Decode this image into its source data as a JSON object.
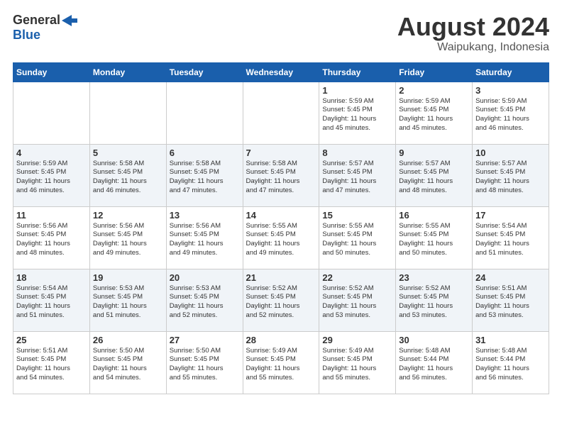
{
  "header": {
    "logo_general": "General",
    "logo_blue": "Blue",
    "month_year": "August 2024",
    "location": "Waipukang, Indonesia"
  },
  "weekdays": [
    "Sunday",
    "Monday",
    "Tuesday",
    "Wednesday",
    "Thursday",
    "Friday",
    "Saturday"
  ],
  "weeks": [
    [
      {
        "day": "",
        "info": ""
      },
      {
        "day": "",
        "info": ""
      },
      {
        "day": "",
        "info": ""
      },
      {
        "day": "",
        "info": ""
      },
      {
        "day": "1",
        "info": "Sunrise: 5:59 AM\nSunset: 5:45 PM\nDaylight: 11 hours\nand 45 minutes."
      },
      {
        "day": "2",
        "info": "Sunrise: 5:59 AM\nSunset: 5:45 PM\nDaylight: 11 hours\nand 45 minutes."
      },
      {
        "day": "3",
        "info": "Sunrise: 5:59 AM\nSunset: 5:45 PM\nDaylight: 11 hours\nand 46 minutes."
      }
    ],
    [
      {
        "day": "4",
        "info": "Sunrise: 5:59 AM\nSunset: 5:45 PM\nDaylight: 11 hours\nand 46 minutes."
      },
      {
        "day": "5",
        "info": "Sunrise: 5:58 AM\nSunset: 5:45 PM\nDaylight: 11 hours\nand 46 minutes."
      },
      {
        "day": "6",
        "info": "Sunrise: 5:58 AM\nSunset: 5:45 PM\nDaylight: 11 hours\nand 47 minutes."
      },
      {
        "day": "7",
        "info": "Sunrise: 5:58 AM\nSunset: 5:45 PM\nDaylight: 11 hours\nand 47 minutes."
      },
      {
        "day": "8",
        "info": "Sunrise: 5:57 AM\nSunset: 5:45 PM\nDaylight: 11 hours\nand 47 minutes."
      },
      {
        "day": "9",
        "info": "Sunrise: 5:57 AM\nSunset: 5:45 PM\nDaylight: 11 hours\nand 48 minutes."
      },
      {
        "day": "10",
        "info": "Sunrise: 5:57 AM\nSunset: 5:45 PM\nDaylight: 11 hours\nand 48 minutes."
      }
    ],
    [
      {
        "day": "11",
        "info": "Sunrise: 5:56 AM\nSunset: 5:45 PM\nDaylight: 11 hours\nand 48 minutes."
      },
      {
        "day": "12",
        "info": "Sunrise: 5:56 AM\nSunset: 5:45 PM\nDaylight: 11 hours\nand 49 minutes."
      },
      {
        "day": "13",
        "info": "Sunrise: 5:56 AM\nSunset: 5:45 PM\nDaylight: 11 hours\nand 49 minutes."
      },
      {
        "day": "14",
        "info": "Sunrise: 5:55 AM\nSunset: 5:45 PM\nDaylight: 11 hours\nand 49 minutes."
      },
      {
        "day": "15",
        "info": "Sunrise: 5:55 AM\nSunset: 5:45 PM\nDaylight: 11 hours\nand 50 minutes."
      },
      {
        "day": "16",
        "info": "Sunrise: 5:55 AM\nSunset: 5:45 PM\nDaylight: 11 hours\nand 50 minutes."
      },
      {
        "day": "17",
        "info": "Sunrise: 5:54 AM\nSunset: 5:45 PM\nDaylight: 11 hours\nand 51 minutes."
      }
    ],
    [
      {
        "day": "18",
        "info": "Sunrise: 5:54 AM\nSunset: 5:45 PM\nDaylight: 11 hours\nand 51 minutes."
      },
      {
        "day": "19",
        "info": "Sunrise: 5:53 AM\nSunset: 5:45 PM\nDaylight: 11 hours\nand 51 minutes."
      },
      {
        "day": "20",
        "info": "Sunrise: 5:53 AM\nSunset: 5:45 PM\nDaylight: 11 hours\nand 52 minutes."
      },
      {
        "day": "21",
        "info": "Sunrise: 5:52 AM\nSunset: 5:45 PM\nDaylight: 11 hours\nand 52 minutes."
      },
      {
        "day": "22",
        "info": "Sunrise: 5:52 AM\nSunset: 5:45 PM\nDaylight: 11 hours\nand 53 minutes."
      },
      {
        "day": "23",
        "info": "Sunrise: 5:52 AM\nSunset: 5:45 PM\nDaylight: 11 hours\nand 53 minutes."
      },
      {
        "day": "24",
        "info": "Sunrise: 5:51 AM\nSunset: 5:45 PM\nDaylight: 11 hours\nand 53 minutes."
      }
    ],
    [
      {
        "day": "25",
        "info": "Sunrise: 5:51 AM\nSunset: 5:45 PM\nDaylight: 11 hours\nand 54 minutes."
      },
      {
        "day": "26",
        "info": "Sunrise: 5:50 AM\nSunset: 5:45 PM\nDaylight: 11 hours\nand 54 minutes."
      },
      {
        "day": "27",
        "info": "Sunrise: 5:50 AM\nSunset: 5:45 PM\nDaylight: 11 hours\nand 55 minutes."
      },
      {
        "day": "28",
        "info": "Sunrise: 5:49 AM\nSunset: 5:45 PM\nDaylight: 11 hours\nand 55 minutes."
      },
      {
        "day": "29",
        "info": "Sunrise: 5:49 AM\nSunset: 5:45 PM\nDaylight: 11 hours\nand 55 minutes."
      },
      {
        "day": "30",
        "info": "Sunrise: 5:48 AM\nSunset: 5:44 PM\nDaylight: 11 hours\nand 56 minutes."
      },
      {
        "day": "31",
        "info": "Sunrise: 5:48 AM\nSunset: 5:44 PM\nDaylight: 11 hours\nand 56 minutes."
      }
    ]
  ]
}
